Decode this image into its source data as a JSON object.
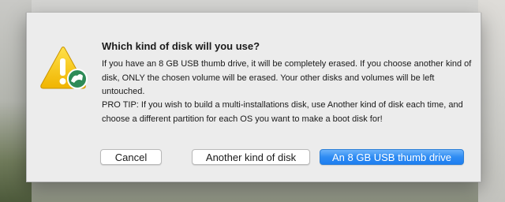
{
  "dialog": {
    "title": "Which kind of disk will you use?",
    "message": "If you have an 8 GB USB thumb drive, it will be completely erased. If you choose another kind of disk, ONLY the chosen volume will be erased. Your other disks and volumes will be left untouched.",
    "pro_tip": "PRO TIP: If you wish to build a multi-installations disk, use Another kind of disk each time, and choose a different partition for each OS you want to make a boot disk for!",
    "icon": "caution-icon"
  },
  "buttons": {
    "cancel": "Cancel",
    "other": "Another kind of disk",
    "default": "An 8 GB USB thumb drive"
  },
  "colors": {
    "default_button": "#1d7ef0",
    "caution_yellow": "#f5c518",
    "badge_green": "#2e8b57"
  }
}
